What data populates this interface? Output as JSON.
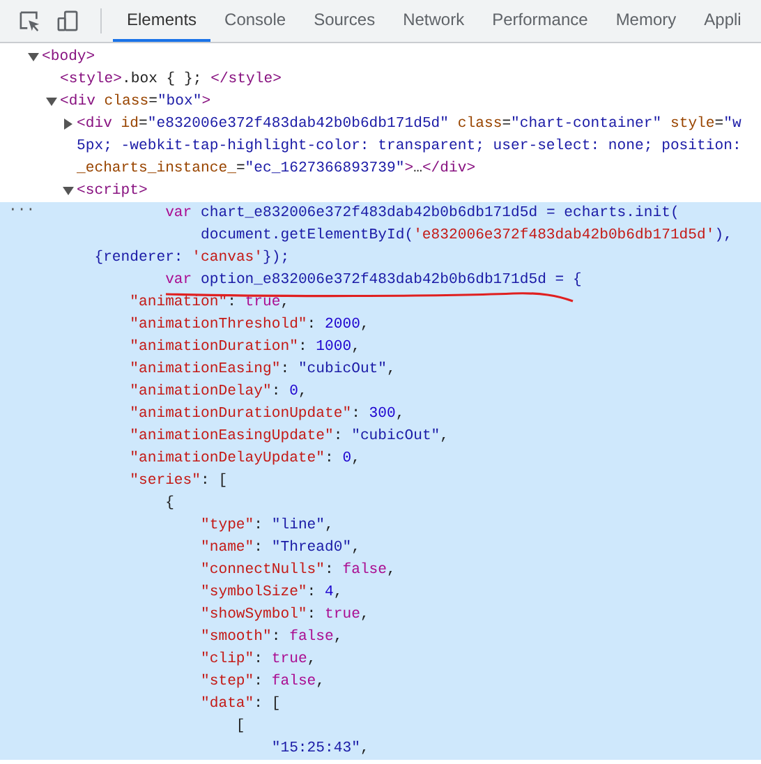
{
  "tabs": [
    {
      "label": "Elements",
      "selected": true
    },
    {
      "label": "Console",
      "selected": false
    },
    {
      "label": "Sources",
      "selected": false
    },
    {
      "label": "Network",
      "selected": false
    },
    {
      "label": "Performance",
      "selected": false
    },
    {
      "label": "Memory",
      "selected": false
    },
    {
      "label": "Appli",
      "selected": false
    }
  ],
  "dom_tree": [
    {
      "kind": "element",
      "expanded": true,
      "selected": false,
      "lines": [
        [
          {
            "kind": "tag",
            "text": "<body>"
          }
        ]
      ],
      "children": [
        {
          "kind": "leaf",
          "selected": false,
          "lines": [
            [
              {
                "kind": "tag",
                "text": "<style>"
              },
              {
                "kind": "text",
                "text": ".box { }; "
              },
              {
                "kind": "tag",
                "text": "</style>"
              }
            ]
          ]
        },
        {
          "kind": "element",
          "expanded": true,
          "selected": false,
          "lines": [
            [
              {
                "kind": "tag",
                "text": "<div"
              },
              {
                "kind": "attr",
                "text": " class"
              },
              {
                "kind": "text",
                "text": "="
              },
              {
                "kind": "val",
                "text": "\"box\""
              },
              {
                "kind": "tag",
                "text": ">"
              }
            ]
          ],
          "children": [
            {
              "kind": "element",
              "expanded": false,
              "selected": false,
              "lines": [
                [
                  {
                    "kind": "tag",
                    "text": "<div"
                  },
                  {
                    "kind": "attr",
                    "text": " id"
                  },
                  {
                    "kind": "text",
                    "text": "="
                  },
                  {
                    "kind": "val",
                    "text": "\"e832006e372f483dab42b0b6db171d5d\""
                  },
                  {
                    "kind": "attr",
                    "text": " class"
                  },
                  {
                    "kind": "text",
                    "text": "="
                  },
                  {
                    "kind": "val",
                    "text": "\"chart-container\""
                  },
                  {
                    "kind": "attr",
                    "text": " style"
                  },
                  {
                    "kind": "text",
                    "text": "="
                  },
                  {
                    "kind": "val",
                    "text": "\"w"
                  }
                ],
                [
                  {
                    "kind": "val",
                    "text": "5px; -webkit-tap-highlight-color: transparent; user-select: none; position:"
                  }
                ],
                [
                  {
                    "kind": "attr",
                    "text": "_echarts_instance_"
                  },
                  {
                    "kind": "text",
                    "text": "="
                  },
                  {
                    "kind": "val",
                    "text": "\"ec_1627366893739\""
                  },
                  {
                    "kind": "tag",
                    "text": ">"
                  },
                  {
                    "kind": "text",
                    "text": "…"
                  },
                  {
                    "kind": "tag",
                    "text": "</div>"
                  }
                ]
              ]
            },
            {
              "kind": "element",
              "expanded": true,
              "selected": false,
              "lines": [
                [
                  {
                    "kind": "tag",
                    "text": "<script>"
                  }
                ]
              ],
              "children": [
                {
                  "kind": "text",
                  "selected": true,
                  "marker": "···",
                  "lines": [
                    [
                      {
                        "kind": "kw",
                        "text": "          var"
                      },
                      {
                        "kind": "ident",
                        "text": " chart_e832006e372f483dab42b0b6db171d5d = echarts.init("
                      }
                    ],
                    [
                      {
                        "kind": "ident",
                        "text": "              document.getElementById("
                      },
                      {
                        "kind": "sq",
                        "text": "'e832006e372f483dab42b0b6db171d5d'"
                      },
                      {
                        "kind": "ident",
                        "text": "),"
                      }
                    ],
                    [
                      {
                        "kind": "ident",
                        "text": "  {renderer: "
                      },
                      {
                        "kind": "sq",
                        "text": "'canvas'"
                      },
                      {
                        "kind": "ident",
                        "text": "});"
                      }
                    ],
                    [
                      {
                        "kind": "kw",
                        "text": "          var"
                      },
                      {
                        "kind": "ident",
                        "text": " option_e832006e372f483dab42b0b6db171d5d = {"
                      }
                    ],
                    [
                      {
                        "kind": "key",
                        "text": "      \"animation\""
                      },
                      {
                        "kind": "text",
                        "text": ": "
                      },
                      {
                        "kind": "bool",
                        "text": "true"
                      },
                      {
                        "kind": "text",
                        "text": ","
                      }
                    ],
                    [
                      {
                        "kind": "key",
                        "text": "      \"animationThreshold\""
                      },
                      {
                        "kind": "text",
                        "text": ": "
                      },
                      {
                        "kind": "num",
                        "text": "2000"
                      },
                      {
                        "kind": "text",
                        "text": ","
                      }
                    ],
                    [
                      {
                        "kind": "key",
                        "text": "      \"animationDuration\""
                      },
                      {
                        "kind": "text",
                        "text": ": "
                      },
                      {
                        "kind": "num",
                        "text": "1000"
                      },
                      {
                        "kind": "text",
                        "text": ","
                      }
                    ],
                    [
                      {
                        "kind": "key",
                        "text": "      \"animationEasing\""
                      },
                      {
                        "kind": "text",
                        "text": ": "
                      },
                      {
                        "kind": "ident",
                        "text": "\"cubicOut\""
                      },
                      {
                        "kind": "text",
                        "text": ","
                      }
                    ],
                    [
                      {
                        "kind": "key",
                        "text": "      \"animationDelay\""
                      },
                      {
                        "kind": "text",
                        "text": ": "
                      },
                      {
                        "kind": "num",
                        "text": "0"
                      },
                      {
                        "kind": "text",
                        "text": ","
                      }
                    ],
                    [
                      {
                        "kind": "key",
                        "text": "      \"animationDurationUpdate\""
                      },
                      {
                        "kind": "text",
                        "text": ": "
                      },
                      {
                        "kind": "num",
                        "text": "300"
                      },
                      {
                        "kind": "text",
                        "text": ","
                      }
                    ],
                    [
                      {
                        "kind": "key",
                        "text": "      \"animationEasingUpdate\""
                      },
                      {
                        "kind": "text",
                        "text": ": "
                      },
                      {
                        "kind": "ident",
                        "text": "\"cubicOut\""
                      },
                      {
                        "kind": "text",
                        "text": ","
                      }
                    ],
                    [
                      {
                        "kind": "key",
                        "text": "      \"animationDelayUpdate\""
                      },
                      {
                        "kind": "text",
                        "text": ": "
                      },
                      {
                        "kind": "num",
                        "text": "0"
                      },
                      {
                        "kind": "text",
                        "text": ","
                      }
                    ],
                    [
                      {
                        "kind": "key",
                        "text": "      \"series\""
                      },
                      {
                        "kind": "text",
                        "text": ": ["
                      }
                    ],
                    [
                      {
                        "kind": "text",
                        "text": "          {"
                      }
                    ],
                    [
                      {
                        "kind": "key",
                        "text": "              \"type\""
                      },
                      {
                        "kind": "text",
                        "text": ": "
                      },
                      {
                        "kind": "ident",
                        "text": "\"line\""
                      },
                      {
                        "kind": "text",
                        "text": ","
                      }
                    ],
                    [
                      {
                        "kind": "key",
                        "text": "              \"name\""
                      },
                      {
                        "kind": "text",
                        "text": ": "
                      },
                      {
                        "kind": "ident",
                        "text": "\"Thread0\""
                      },
                      {
                        "kind": "text",
                        "text": ","
                      }
                    ],
                    [
                      {
                        "kind": "key",
                        "text": "              \"connectNulls\""
                      },
                      {
                        "kind": "text",
                        "text": ": "
                      },
                      {
                        "kind": "bool",
                        "text": "false"
                      },
                      {
                        "kind": "text",
                        "text": ","
                      }
                    ],
                    [
                      {
                        "kind": "key",
                        "text": "              \"symbolSize\""
                      },
                      {
                        "kind": "text",
                        "text": ": "
                      },
                      {
                        "kind": "num",
                        "text": "4"
                      },
                      {
                        "kind": "text",
                        "text": ","
                      }
                    ],
                    [
                      {
                        "kind": "key",
                        "text": "              \"showSymbol\""
                      },
                      {
                        "kind": "text",
                        "text": ": "
                      },
                      {
                        "kind": "bool",
                        "text": "true"
                      },
                      {
                        "kind": "text",
                        "text": ","
                      }
                    ],
                    [
                      {
                        "kind": "key",
                        "text": "              \"smooth\""
                      },
                      {
                        "kind": "text",
                        "text": ": "
                      },
                      {
                        "kind": "bool",
                        "text": "false"
                      },
                      {
                        "kind": "text",
                        "text": ","
                      }
                    ],
                    [
                      {
                        "kind": "key",
                        "text": "              \"clip\""
                      },
                      {
                        "kind": "text",
                        "text": ": "
                      },
                      {
                        "kind": "bool",
                        "text": "true"
                      },
                      {
                        "kind": "text",
                        "text": ","
                      }
                    ],
                    [
                      {
                        "kind": "key",
                        "text": "              \"step\""
                      },
                      {
                        "kind": "text",
                        "text": ": "
                      },
                      {
                        "kind": "bool",
                        "text": "false"
                      },
                      {
                        "kind": "text",
                        "text": ","
                      }
                    ],
                    [
                      {
                        "kind": "key",
                        "text": "              \"data\""
                      },
                      {
                        "kind": "text",
                        "text": ": ["
                      }
                    ],
                    [
                      {
                        "kind": "text",
                        "text": "                  ["
                      }
                    ],
                    [
                      {
                        "kind": "ident",
                        "text": "                      \"15:25:43\""
                      },
                      {
                        "kind": "text",
                        "text": ","
                      }
                    ]
                  ]
                }
              ]
            }
          ]
        }
      ]
    }
  ]
}
